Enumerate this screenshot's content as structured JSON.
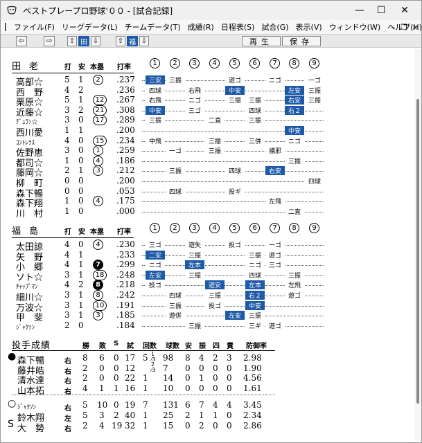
{
  "window": {
    "title": "ベストプレープロ野球'００ - [試合記録]",
    "controls": [
      "—",
      "☐",
      "✕"
    ]
  },
  "menu": [
    "ファイル(F)",
    "リーグデータ(L)",
    "チームデータ(T)",
    "成績(R)",
    "日程表(S)",
    "試合(G)",
    "表示(V)",
    "ウィンドウ(W)",
    "ヘルプ(H)"
  ],
  "toolbar": {
    "home_team_label": "田",
    "away_team_label": "福",
    "replay_label": "再生",
    "save_label": "保存"
  },
  "inning_headers": [
    "①",
    "②",
    "③",
    "④",
    "⑤",
    "⑥",
    "⑦",
    "⑧",
    "⑨"
  ],
  "col_headers": {
    "ab": "打",
    "h": "安",
    "hr": "本塁",
    "avg": "打率"
  },
  "teams": [
    {
      "name": "田老",
      "rows": [
        {
          "name": "高部☆",
          "ab": "5",
          "h": "1",
          "hr": "2",
          "hr_filled": false,
          "avg": ".237",
          "res": [
            {
              "i": 0,
              "t": "三安",
              "hl": true
            },
            {
              "i": 1,
              "t": "三振"
            },
            {
              "i": 4,
              "t": "遊ゴ"
            },
            {
              "i": 6,
              "t": "ニゴ"
            },
            {
              "i": 8,
              "t": "一ゴ"
            }
          ]
        },
        {
          "name": "西　野",
          "ab": "4",
          "h": "2",
          "hr": "",
          "hr_filled": false,
          "avg": ".236",
          "res": [
            {
              "i": 0,
              "t": "四球"
            },
            {
              "i": 2,
              "t": "右飛"
            },
            {
              "i": 4,
              "t": "中安",
              "hl": true
            },
            {
              "i": 7,
              "t": "左安",
              "hl": true
            },
            {
              "i": 8,
              "t": "三振"
            }
          ]
        },
        {
          "name": "栗原☆",
          "ab": "5",
          "h": "1",
          "hr": "12",
          "hr_filled": false,
          "avg": ".267",
          "res": [
            {
              "i": 0,
              "t": "右飛"
            },
            {
              "i": 2,
              "t": "ニゴ"
            },
            {
              "i": 4,
              "t": "三振"
            },
            {
              "i": 5,
              "t": "三振"
            },
            {
              "i": 7,
              "t": "右安",
              "hl": true
            },
            {
              "i": 8,
              "t": "三振"
            }
          ]
        },
        {
          "name": "近藤☆",
          "ab": "3",
          "h": "2",
          "hr": "21",
          "hr_filled": false,
          "avg": ".308",
          "res": [
            {
              "i": 0,
              "t": "中安",
              "hl": true
            },
            {
              "i": 2,
              "t": "三ゴ"
            },
            {
              "i": 5,
              "t": "四球"
            },
            {
              "i": 7,
              "t": "右２",
              "hl": true
            }
          ]
        },
        {
          "name": "ﾃﾞｭﾗﾝ☆",
          "small": true,
          "ab": "3",
          "h": "0",
          "hr": "17",
          "hr_filled": false,
          "avg": ".289",
          "res": [
            {
              "i": 0,
              "t": "三振"
            },
            {
              "i": 3,
              "t": "二直"
            },
            {
              "i": 5,
              "t": "三振"
            }
          ]
        },
        {
          "name": "西川愛",
          "ab": "1",
          "h": "1",
          "hr": "",
          "hr_filled": false,
          "avg": ".200",
          "res": [
            {
              "i": 7,
              "t": "中安",
              "hl": true
            }
          ]
        },
        {
          "name": "ｺﾝﾄﾚﾗｽ",
          "small": true,
          "ab": "4",
          "h": "0",
          "hr": "15",
          "hr_filled": false,
          "avg": ".234",
          "res": [
            {
              "i": 0,
              "t": "中飛"
            },
            {
              "i": 3,
              "t": "三振"
            },
            {
              "i": 5,
              "t": "三併"
            },
            {
              "i": 7,
              "t": "ニゴ"
            }
          ]
        },
        {
          "name": "佐野恵",
          "ab": "3",
          "h": "0",
          "hr": "1",
          "hr_filled": false,
          "avg": ".259",
          "res": [
            {
              "i": 1,
              "t": "一ゴ"
            },
            {
              "i": 3,
              "t": "三振"
            },
            {
              "i": 6,
              "t": "捕邪"
            }
          ]
        },
        {
          "name": "都司☆",
          "ab": "1",
          "h": "0",
          "hr": "4",
          "hr_filled": false,
          "avg": ".186",
          "res": [
            {
              "i": 7,
              "t": "三振"
            }
          ]
        },
        {
          "name": "藤岡☆",
          "ab": "2",
          "h": "1",
          "hr": "3",
          "hr_filled": false,
          "avg": ".212",
          "res": [
            {
              "i": 1,
              "t": "三振"
            },
            {
              "i": 4,
              "t": "四球"
            },
            {
              "i": 6,
              "t": "右安",
              "hl": true
            }
          ]
        },
        {
          "name": "柳　町",
          "ab": "0",
          "h": "0",
          "hr": "",
          "hr_filled": false,
          "avg": ".200",
          "res": [
            {
              "i": 8,
              "t": "四球"
            }
          ]
        },
        {
          "name": "森下暢",
          "ab": "0",
          "h": "0",
          "hr": "",
          "hr_filled": false,
          "avg": ".053",
          "res": [
            {
              "i": 1,
              "t": "四球"
            },
            {
              "i": 4,
              "t": "投ギ"
            }
          ]
        },
        {
          "name": "森下翔",
          "ab": "1",
          "h": "0",
          "hr": "4",
          "hr_filled": false,
          "avg": ".175",
          "res": [
            {
              "i": 6,
              "t": "左飛"
            }
          ]
        },
        {
          "name": "川　村",
          "ab": "1",
          "h": "0",
          "hr": "",
          "hr_filled": false,
          "avg": ".000",
          "res": [
            {
              "i": 7,
              "t": "二直"
            }
          ]
        }
      ]
    },
    {
      "name": "福島",
      "rows": [
        {
          "name": "太田諒",
          "ab": "4",
          "h": "0",
          "hr": "4",
          "hr_filled": false,
          "avg": ".230",
          "res": [
            {
              "i": 0,
              "t": "三ゴ"
            },
            {
              "i": 2,
              "t": "遊失"
            },
            {
              "i": 4,
              "t": "投ゴ"
            },
            {
              "i": 6,
              "t": "一ゴ"
            }
          ]
        },
        {
          "name": "矢　野",
          "ab": "4",
          "h": "1",
          "hr": "",
          "hr_filled": false,
          "avg": ".233",
          "res": [
            {
              "i": 0,
              "t": "二安",
              "hl": true
            },
            {
              "i": 2,
              "t": "三振"
            },
            {
              "i": 5,
              "t": "三振"
            },
            {
              "i": 6,
              "t": "遊ゴ"
            }
          ]
        },
        {
          "name": "小　郷",
          "ab": "4",
          "h": "1",
          "hr": "7",
          "hr_filled": true,
          "avg": ".299",
          "res": [
            {
              "i": 0,
              "t": "ニゴ"
            },
            {
              "i": 2,
              "t": "左本",
              "hl": true
            },
            {
              "i": 5,
              "t": "ニゴ"
            },
            {
              "i": 6,
              "t": "三ゴ"
            }
          ]
        },
        {
          "name": "ソト☆",
          "ab": "3",
          "h": "1",
          "hr": "18",
          "hr_filled": false,
          "avg": ".248",
          "res": [
            {
              "i": 0,
              "t": "左安",
              "hl": true
            },
            {
              "i": 2,
              "t": "三振"
            },
            {
              "i": 5,
              "t": "四球"
            },
            {
              "i": 7,
              "t": "三振"
            }
          ]
        },
        {
          "name": "ﾁｬｯﾌﾟﾏﾝ",
          "small": true,
          "ab": "4",
          "h": "2",
          "hr": "8",
          "hr_filled": true,
          "avg": ".218",
          "res": [
            {
              "i": 0,
              "t": "投ゴ"
            },
            {
              "i": 3,
              "t": "遊安",
              "hl": true
            },
            {
              "i": 5,
              "t": "左本",
              "hl": true
            },
            {
              "i": 7,
              "t": "左飛"
            }
          ]
        },
        {
          "name": "細川☆",
          "ab": "3",
          "h": "1",
          "hr": "8",
          "hr_filled": false,
          "avg": ".242",
          "res": [
            {
              "i": 1,
              "t": "四球"
            },
            {
              "i": 3,
              "t": "三振"
            },
            {
              "i": 5,
              "t": "右２",
              "hl": true
            },
            {
              "i": 7,
              "t": "遊ゴ"
            }
          ]
        },
        {
          "name": "万波☆",
          "ab": "3",
          "h": "1",
          "hr": "10",
          "hr_filled": false,
          "avg": ".191",
          "res": [
            {
              "i": 1,
              "t": "三振"
            },
            {
              "i": 3,
              "t": "投ゴ"
            },
            {
              "i": 5,
              "t": "中安",
              "hl": true
            }
          ]
        },
        {
          "name": "甲　斐",
          "ab": "3",
          "h": "1",
          "hr": "3",
          "hr_filled": false,
          "avg": ".185",
          "res": [
            {
              "i": 1,
              "t": "遊併"
            },
            {
              "i": 4,
              "t": "左安",
              "hl": true
            },
            {
              "i": 5,
              "t": "三振"
            }
          ]
        },
        {
          "name": "ｼﾞｬｸｿﾝ",
          "small": true,
          "ab": "2",
          "h": "0",
          "hr": "",
          "hr_filled": false,
          "avg": ".184",
          "res": [
            {
              "i": 2,
              "t": "三振"
            },
            {
              "i": 5,
              "t": "三ギ"
            },
            {
              "i": 6,
              "t": "遊ゴ"
            }
          ]
        }
      ]
    }
  ],
  "pitching": {
    "title": "投手成績",
    "headers": [
      "勝",
      "敗",
      "S",
      "試",
      "回数",
      "球数",
      "安",
      "振",
      "四",
      "責",
      "防御率"
    ],
    "groups": [
      {
        "rows": [
          {
            "marker": "●",
            "name": "森下暢",
            "hand": "右",
            "w": "8",
            "l": "6",
            "s": "0",
            "g": "17",
            "ip": "5",
            "ip_frac": "1/3",
            "pc": "98",
            "h": "8",
            "k": "4",
            "bb": "2",
            "er": "3",
            "era": "2.98"
          },
          {
            "marker": "",
            "name": "藤井皓",
            "hand": "右",
            "w": "2",
            "l": "0",
            "s": "0",
            "g": "12",
            "ip": "",
            "ip_frac": "2/3",
            "pc": "7",
            "h": "0",
            "k": "0",
            "bb": "0",
            "er": "0",
            "era": "1.90"
          },
          {
            "marker": "",
            "name": "清水達",
            "hand": "右",
            "w": "2",
            "l": "0",
            "s": "0",
            "g": "22",
            "ip": "1",
            "ip_frac": "",
            "pc": "14",
            "h": "0",
            "k": "1",
            "bb": "0",
            "er": "0",
            "era": "4.56"
          },
          {
            "marker": "",
            "name": "山本拓",
            "hand": "右",
            "w": "4",
            "l": "1",
            "s": "1",
            "g": "16",
            "ip": "1",
            "ip_frac": "",
            "pc": "10",
            "h": "0",
            "k": "0",
            "bb": "0",
            "er": "0",
            "era": "1.61"
          }
        ]
      },
      {
        "rows": [
          {
            "marker": "○",
            "name": "ｼﾞｬｸｿﾝ",
            "small": true,
            "hand": "右",
            "w": "5",
            "l": "10",
            "s": "0",
            "g": "19",
            "ip": "7",
            "ip_frac": "",
            "pc": "131",
            "h": "6",
            "k": "7",
            "bb": "4",
            "er": "4",
            "era": "3.45"
          },
          {
            "marker": "",
            "name": "鈴木翔",
            "hand": "左",
            "w": "5",
            "l": "3",
            "s": "2",
            "g": "40",
            "ip": "1",
            "ip_frac": "",
            "pc": "25",
            "h": "2",
            "k": "1",
            "bb": "1",
            "er": "0",
            "era": "2.34"
          },
          {
            "marker": "S",
            "name": "大　勢",
            "hand": "右",
            "w": "2",
            "l": "4",
            "s": "19",
            "g": "32",
            "ip": "1",
            "ip_frac": "",
            "pc": "15",
            "h": "0",
            "k": "2",
            "bb": "0",
            "er": "0",
            "era": "2.86"
          }
        ]
      }
    ]
  }
}
